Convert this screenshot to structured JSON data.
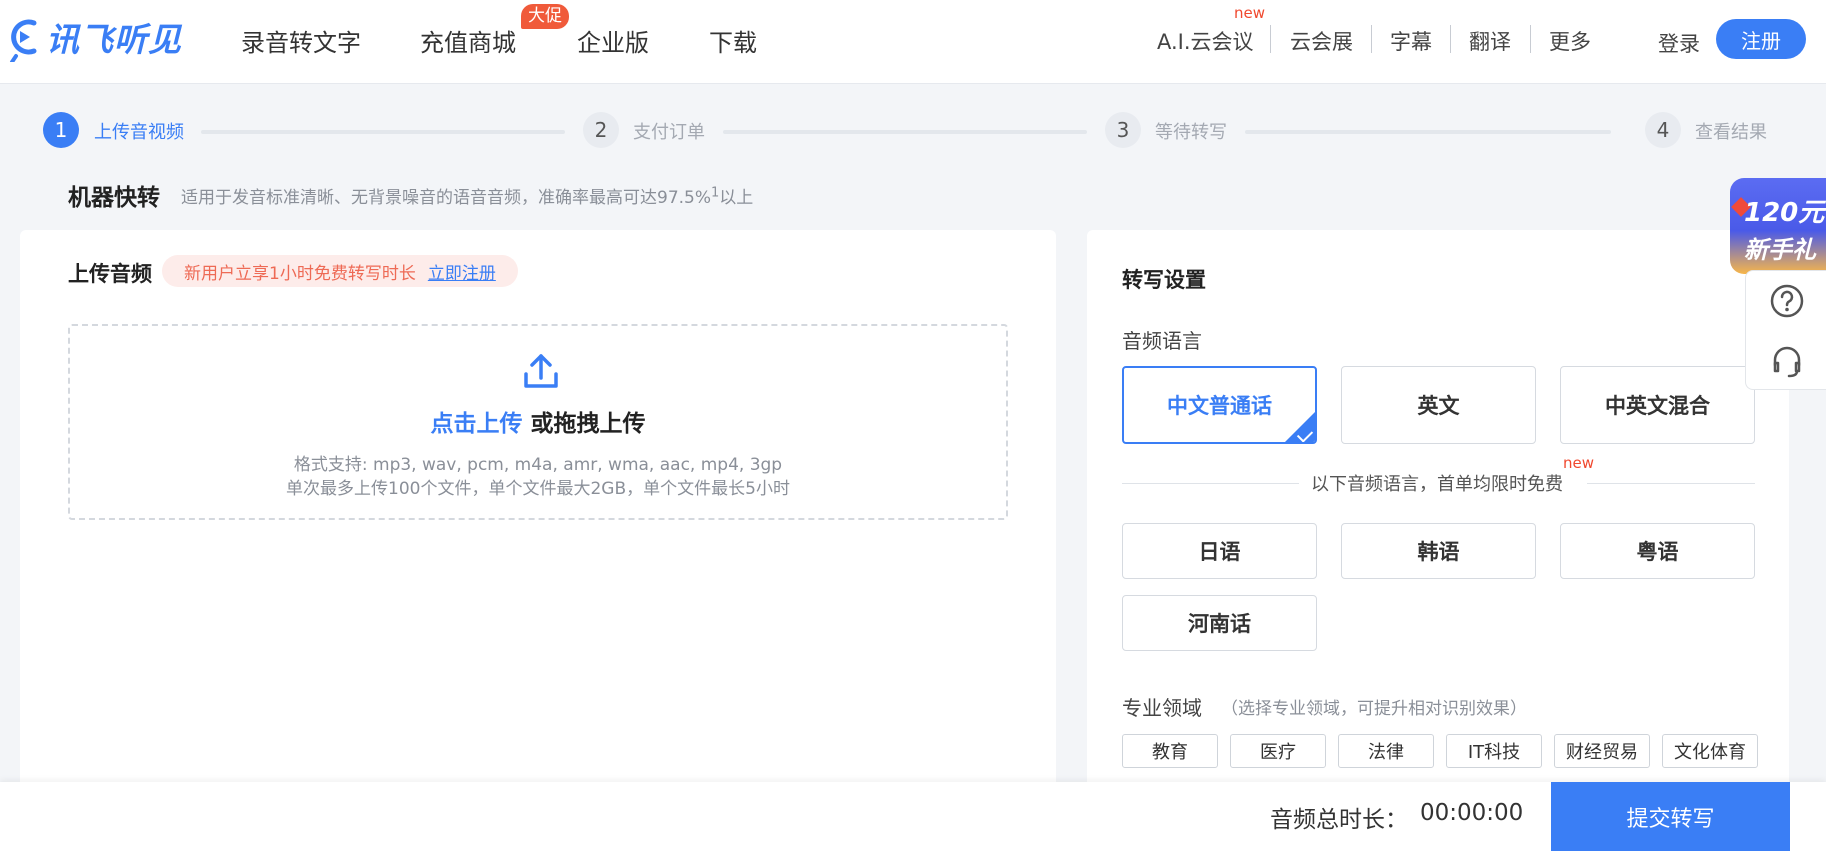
{
  "header": {
    "logo_text": "讯飞听见",
    "nav": [
      "录音转文字",
      "充值商城",
      "企业版",
      "下载"
    ],
    "nav_badge": "大促",
    "right_links": [
      "A.I.云会议",
      "云会展",
      "字幕",
      "翻译",
      "更多"
    ],
    "new_tag": "new",
    "login": "登录",
    "register": "注册"
  },
  "steps": [
    {
      "num": "1",
      "label": "上传音视频"
    },
    {
      "num": "2",
      "label": "支付订单"
    },
    {
      "num": "3",
      "label": "等待转写"
    },
    {
      "num": "4",
      "label": "查看结果"
    }
  ],
  "mode": {
    "title": "机器快转",
    "desc": "适用于发音标准清晰、无背景噪音的语音音频，准确率最高可达97.5%",
    "desc_sup": "1",
    "desc_tail": "以上"
  },
  "upload": {
    "title": "上传音频",
    "promo_text": "新用户立享1小时免费转写时长",
    "promo_link": "立即注册",
    "click_text": "点击上传",
    "drag_text": " 或拖拽上传",
    "formats": "格式支持: mp3, wav, pcm, m4a, amr, wma, aac, mp4, 3gp",
    "limits": "单次最多上传100个文件，单个文件最大2GB，单个文件最长5小时"
  },
  "settings": {
    "title": "转写设置",
    "lang_label": "音频语言",
    "langs": [
      "中文普通话",
      "英文",
      "中英文混合"
    ],
    "free_note": "以下音频语言，首单均限时免费",
    "new_tag": "new",
    "more_langs": [
      "日语",
      "韩语",
      "粤语",
      "河南话"
    ],
    "domain_label": "专业领域",
    "domain_hint": "（选择专业领域，可提升相对识别效果）",
    "domains": [
      "教育",
      "医疗",
      "法律",
      "IT科技",
      "财经贸易",
      "文化体育"
    ]
  },
  "float_promo": {
    "line1": "120元",
    "line2": "新手礼"
  },
  "bottom": {
    "duration_label": "音频总时长：",
    "duration_value": "00:00:00",
    "submit": "提交转写"
  },
  "colors": {
    "primary": "#3a7ef5",
    "badge": "#f05a3a",
    "promo_bg": "#fdecea",
    "promo_text": "#ee6a55"
  }
}
